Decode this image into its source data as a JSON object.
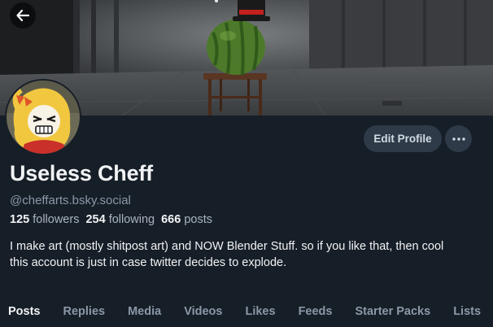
{
  "profile": {
    "display_name": "Useless Cheff",
    "handle": "@cheffarts.bsky.social",
    "followers_count": "125",
    "followers_label": "followers",
    "following_count": "254",
    "following_label": "following",
    "posts_count": "666",
    "posts_label": "posts",
    "bio_line1": "I make art (mostly shitpost art) and NOW Blender Stuff. so if you like that, then cool",
    "bio_line2": "this account is just in case twitter decides to explode."
  },
  "actions": {
    "edit_profile_label": "Edit Profile"
  },
  "tabs": [
    {
      "label": "Posts",
      "active": true
    },
    {
      "label": "Replies",
      "active": false
    },
    {
      "label": "Media",
      "active": false
    },
    {
      "label": "Videos",
      "active": false
    },
    {
      "label": "Likes",
      "active": false
    },
    {
      "label": "Feeds",
      "active": false
    },
    {
      "label": "Starter Packs",
      "active": false
    },
    {
      "label": "Lists",
      "active": false
    }
  ],
  "icons": {
    "back": "arrow-left-icon",
    "more": "ellipsis-icon"
  },
  "colors": {
    "background": "#161e27",
    "button_bg": "#2e3a48",
    "muted_text": "#8b98a8"
  }
}
